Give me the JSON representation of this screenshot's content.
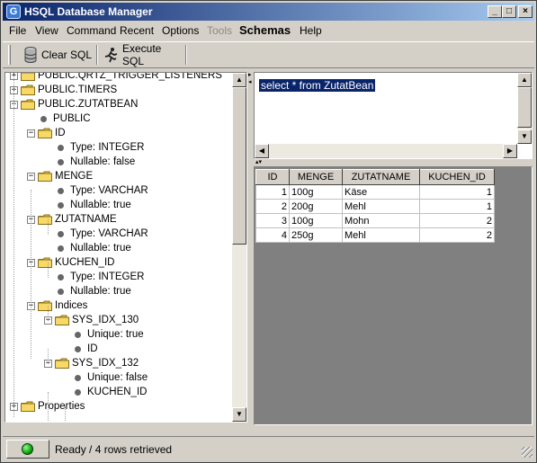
{
  "window": {
    "title": "HSQL Database Manager"
  },
  "menu": [
    "File",
    "View",
    "Command",
    "Recent",
    "Options",
    "Tools",
    "Schemas",
    "Help"
  ],
  "toolbar": {
    "clear_label": "Clear SQL",
    "execute_label": "Execute SQL"
  },
  "tree": [
    {
      "label": "PUBLIC.QRTZ_TRIGGER_LISTENERS",
      "kind": "folder",
      "expander": "+"
    },
    {
      "label": "PUBLIC.TIMERS",
      "kind": "folder",
      "expander": "+"
    },
    {
      "label": "PUBLIC.ZUTATBEAN",
      "kind": "folder",
      "expander": "-"
    },
    {
      "label": "PUBLIC",
      "kind": "leaf"
    },
    {
      "label": "ID",
      "kind": "folder",
      "expander": "-"
    },
    {
      "label": "Type: INTEGER",
      "kind": "leaf"
    },
    {
      "label": "Nullable: false",
      "kind": "leaf"
    },
    {
      "label": "MENGE",
      "kind": "folder",
      "expander": "-"
    },
    {
      "label": "Type: VARCHAR",
      "kind": "leaf"
    },
    {
      "label": "Nullable: true",
      "kind": "leaf"
    },
    {
      "label": "ZUTATNAME",
      "kind": "folder",
      "expander": "-"
    },
    {
      "label": "Type: VARCHAR",
      "kind": "leaf"
    },
    {
      "label": "Nullable: true",
      "kind": "leaf"
    },
    {
      "label": "KUCHEN_ID",
      "kind": "folder",
      "expander": "-"
    },
    {
      "label": "Type: INTEGER",
      "kind": "leaf"
    },
    {
      "label": "Nullable: true",
      "kind": "leaf"
    },
    {
      "label": "Indices",
      "kind": "folder",
      "expander": "-"
    },
    {
      "label": "SYS_IDX_130",
      "kind": "folder",
      "expander": "-"
    },
    {
      "label": "Unique: true",
      "kind": "leaf"
    },
    {
      "label": "ID",
      "kind": "leaf"
    },
    {
      "label": "SYS_IDX_132",
      "kind": "folder",
      "expander": "-"
    },
    {
      "label": "Unique: false",
      "kind": "leaf"
    },
    {
      "label": "KUCHEN_ID",
      "kind": "leaf"
    },
    {
      "label": "Properties",
      "kind": "folder",
      "expander": "+"
    }
  ],
  "sql": {
    "text": "select * from ZutatBean"
  },
  "results": {
    "columns": [
      "ID",
      "MENGE",
      "ZUTATNAME",
      "KUCHEN_ID"
    ],
    "rows": [
      [
        "1",
        "100g",
        "Käse",
        "1"
      ],
      [
        "2",
        "200g",
        "Mehl",
        "1"
      ],
      [
        "3",
        "100g",
        "Mohn",
        "2"
      ],
      [
        "4",
        "250g",
        "Mehl",
        "2"
      ]
    ]
  },
  "status": {
    "text": "Ready / 4 rows retrieved"
  },
  "colors": {
    "title_start": "#0a246a",
    "title_end": "#a6caf0",
    "selection": "#0a246a",
    "status_light": "#0fa00f"
  }
}
